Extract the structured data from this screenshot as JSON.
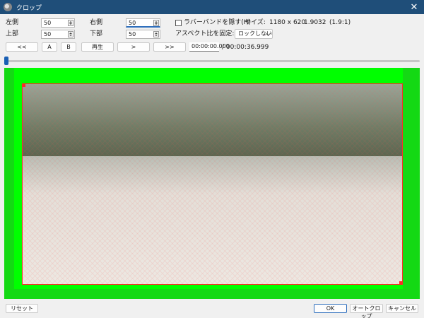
{
  "window": {
    "title": "クロップ",
    "close_glyph": "✕",
    "icon": "app-icon"
  },
  "crop": {
    "left_label": "左側",
    "left_value": "50",
    "top_label": "上部",
    "top_value": "50",
    "right_label": "右側",
    "right_value": "50",
    "bottom_label": "下部",
    "bottom_value": "50"
  },
  "options": {
    "hide_rubberband_label": "ラバーバンドを隠す(H)",
    "hide_rubberband_checked": false,
    "size_label": "サイズ:",
    "size_value": "1180 x 620",
    "ratio_value": "1.9032",
    "ratio_fraction": "(1.9:1)",
    "lock_aspect_label": "アスペクト比を固定:",
    "lock_aspect_value": "ロックしない"
  },
  "playback": {
    "rewind_label": "<<",
    "a_label": "A",
    "b_label": "B",
    "play_label": "再生",
    "next_label": ">",
    "fast_forward_label": ">>",
    "current_time": "00:00:00.000",
    "duration": "/ 00:00:36.999",
    "position_fraction": 0
  },
  "footer": {
    "reset_label": "リセット",
    "ok_label": "OK",
    "autocrop_label": "オートクロップ",
    "cancel_label": "キャンセル"
  },
  "colors": {
    "titlebar": "#1f4e79",
    "background_fill": "#00ff00",
    "crop_border": "#ff2a2a",
    "accent": "#1a5fb4"
  }
}
